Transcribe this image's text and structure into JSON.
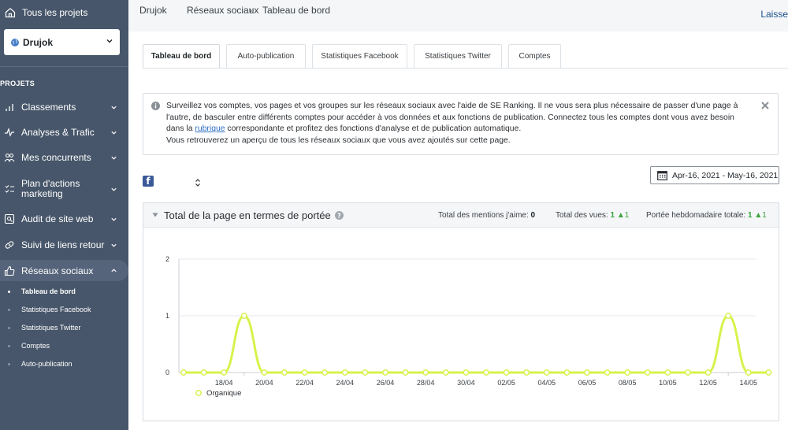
{
  "sidebar": {
    "all_projects": "Tous les projets",
    "project": "Drujok",
    "section_label": "PROJETS",
    "items": [
      {
        "label": "Classements",
        "icon": "bar-chart-icon"
      },
      {
        "label": "Analyses & Trafic",
        "icon": "pulse-icon"
      },
      {
        "label": "Mes concurrents",
        "icon": "users-icon"
      },
      {
        "label": "Plan d'actions marketing",
        "icon": "checklist-icon"
      },
      {
        "label": "Audit de site web",
        "icon": "audit-icon"
      },
      {
        "label": "Suivi de liens retour",
        "icon": "link-icon"
      },
      {
        "label": "Réseaux sociaux",
        "icon": "thumbs-up-icon"
      }
    ],
    "subitems": [
      "Tableau de bord",
      "Statistiques Facebook",
      "Statistiques Twitter",
      "Comptes",
      "Auto-publication"
    ]
  },
  "header": {
    "breadcrumb": [
      "Drujok",
      "Réseaux sociaux",
      "Tableau de bord"
    ],
    "right_link": "Laisse"
  },
  "tabs": [
    "Tableau de bord",
    "Auto-publication",
    "Statistiques Facebook",
    "Statistiques Twitter",
    "Comptes"
  ],
  "info": {
    "text_before": "Surveillez vos comptes, vos pages et vos groupes sur les réseaux sociaux avec l'aide de SE Ranking. Il ne vous sera plus nécessaire de passer d'une page à l'autre, de basculer entre différents comptes pour accéder à vos données et aux fonctions de publication. Connectez tous les comptes dont vous avez besoin dans la ",
    "link": "rubrique",
    "text_after": " correspondante et profitez des fonctions d'analyse et de publication automatique.",
    "line2": "Vous retrouverez un aperçu de tous les réseaux sociaux que vous avez ajoutés sur cette page."
  },
  "date_range": "Apr-16, 2021 - May-16, 2021",
  "panel": {
    "title": "Total de la page en termes de portée",
    "likes_label": "Total des mentions j'aime:",
    "likes_value": "0",
    "views_label": "Total des vues:",
    "views_value": "1",
    "views_delta": "▲1",
    "weekly_label": "Portée hebdomadaire totale:",
    "weekly_value": "1",
    "weekly_delta": "▲1"
  },
  "colors": {
    "sidebar": "#47566a",
    "series": "#d7f24a",
    "accent_up": "#3aa33a",
    "facebook": "#3b5998"
  },
  "chart_data": {
    "type": "line",
    "ylim": [
      0,
      2
    ],
    "yticks": [
      0,
      1,
      2
    ],
    "x": [
      "16/04",
      "17/04",
      "18/04",
      "19/04",
      "20/04",
      "21/04",
      "22/04",
      "23/04",
      "24/04",
      "25/04",
      "26/04",
      "27/04",
      "28/04",
      "29/04",
      "30/04",
      "01/05",
      "02/05",
      "03/05",
      "04/05",
      "05/05",
      "06/05",
      "07/05",
      "08/05",
      "09/05",
      "10/05",
      "11/05",
      "12/05",
      "13/05",
      "14/05",
      "15/05"
    ],
    "xtick_labels": [
      "18/04",
      "20/04",
      "22/04",
      "24/04",
      "26/04",
      "28/04",
      "30/04",
      "02/05",
      "04/05",
      "06/05",
      "08/05",
      "10/05",
      "12/05",
      "14/05"
    ],
    "series": [
      {
        "name": "Organique",
        "values": [
          0,
          0,
          0,
          1,
          0,
          0,
          0,
          0,
          0,
          0,
          0,
          0,
          0,
          0,
          0,
          0,
          0,
          0,
          0,
          0,
          0,
          0,
          0,
          0,
          0,
          0,
          0,
          1,
          0,
          0
        ]
      }
    ],
    "grid": true,
    "legend": "bottom-left"
  }
}
